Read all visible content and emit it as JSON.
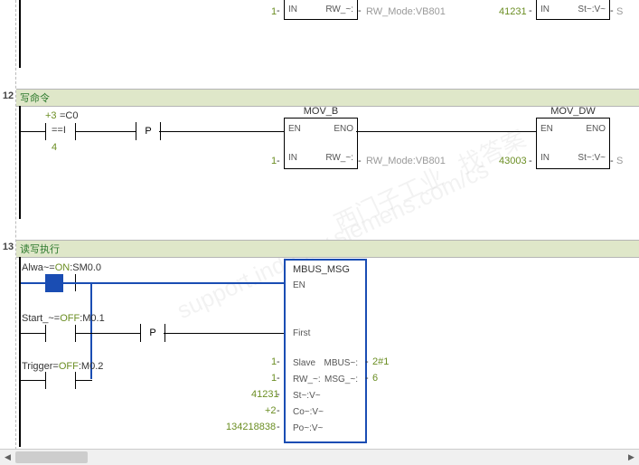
{
  "network_top": {
    "in_left": "1",
    "in_lbl": "IN",
    "rw_lbl": "RW_~:",
    "rw_mode": "RW_Mode:VB801",
    "addr": "41231",
    "in2_lbl": "IN",
    "st_lbl": "St~:V~",
    "s_suffix": "S"
  },
  "network12": {
    "num": "12",
    "title": "写命令",
    "plus3": "+3",
    "c0": "=C0",
    "eq_i": "==I",
    "four": "4",
    "p": "P",
    "mov_b": {
      "title": "MOV_B",
      "en": "EN",
      "eno": "ENO",
      "in_left": "1",
      "in_lbl": "IN",
      "rw_lbl": "RW_~:",
      "rw_mode": "RW_Mode:VB801"
    },
    "addr": "43003",
    "mov_dw": {
      "title": "MOV_DW",
      "en": "EN",
      "eno": "ENO",
      "in_lbl": "IN",
      "st_lbl": "St~:V~",
      "s_suffix": "S"
    }
  },
  "network13": {
    "num": "13",
    "title": "读写执行",
    "alwa": "Alwa~=",
    "on": "ON",
    "sm": ":SM0.0",
    "start": "Start_~=",
    "off1": "OFF",
    "m01": ":M0.1",
    "trigger": "Trigger=",
    "off2": "OFF",
    "m02": ":M0.2",
    "p": "P",
    "mbus": {
      "title": "MBUS_MSG",
      "en": "EN",
      "first": "First",
      "rows": [
        {
          "lval": "1",
          "llabel": "Slave",
          "rlabel": "MBUS~:",
          "rval": "2#1"
        },
        {
          "lval": "1",
          "llabel": "RW_~:",
          "rlabel": "MSG_~:",
          "rval": "6"
        },
        {
          "lval": "41231",
          "llabel": "St~:V~",
          "rlabel": "",
          "rval": ""
        },
        {
          "lval": "+2",
          "llabel": "Co~:V~",
          "rlabel": "",
          "rval": ""
        },
        {
          "lval": "134218838",
          "llabel": "Po~:V~",
          "rlabel": "",
          "rval": ""
        }
      ]
    }
  },
  "scrollbar": {
    "left_arrow": "◀",
    "right_arrow": "▶"
  }
}
